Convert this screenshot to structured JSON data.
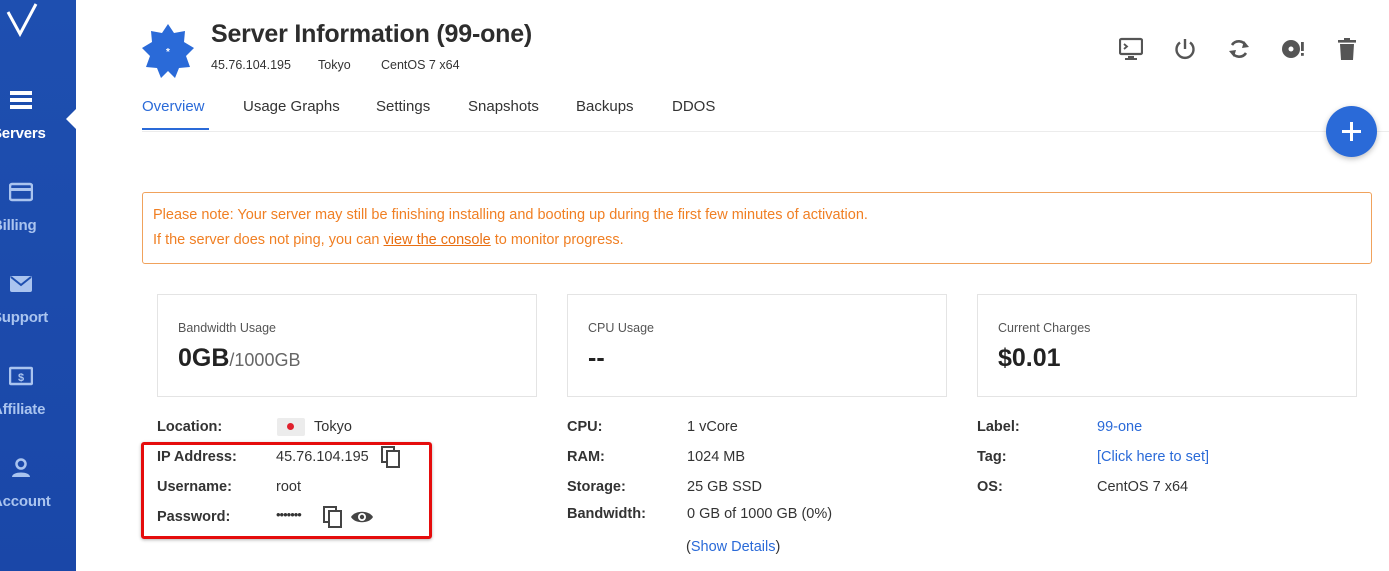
{
  "sidebar": {
    "items": [
      {
        "label": "Servers",
        "icon": "servers-icon",
        "active": true
      },
      {
        "label": "Billing",
        "icon": "billing-icon"
      },
      {
        "label": "Support",
        "icon": "support-icon"
      },
      {
        "label": "Affiliate",
        "icon": "affiliate-icon"
      },
      {
        "label": "Account",
        "icon": "account-icon"
      }
    ]
  },
  "header": {
    "title": "Server Information (99-one)",
    "ip": "45.76.104.195",
    "location": "Tokyo",
    "os": "CentOS 7 x64"
  },
  "toolbar": {
    "icons": [
      "console-icon",
      "power-icon",
      "restart-icon",
      "reinstall-icon",
      "delete-icon"
    ]
  },
  "tabs": [
    "Overview",
    "Usage Graphs",
    "Settings",
    "Snapshots",
    "Backups",
    "DDOS"
  ],
  "active_tab": "Overview",
  "notice": {
    "line1": "Please note: Your server may still be finishing installing and booting up during the first few minutes of activation.",
    "line2_prefix": "If the server does not ping, you can ",
    "line2_link": "view the console",
    "line2_suffix": " to monitor progress."
  },
  "cards": {
    "bandwidth": {
      "label": "Bandwidth Usage",
      "value": "0GB",
      "sub": "/1000GB"
    },
    "cpu": {
      "label": "CPU Usage",
      "value": "--"
    },
    "charges": {
      "label": "Current Charges",
      "value": "$0.01"
    }
  },
  "details": {
    "location": {
      "label": "Location:",
      "value": "Tokyo"
    },
    "ip": {
      "label": "IP Address:",
      "value": "45.76.104.195"
    },
    "username": {
      "label": "Username:",
      "value": "root"
    },
    "password": {
      "label": "Password:",
      "value": "•••••••"
    },
    "cpu": {
      "label": "CPU:",
      "value": "1 vCore"
    },
    "ram": {
      "label": "RAM:",
      "value": "1024 MB"
    },
    "storage": {
      "label": "Storage:",
      "value": "25 GB SSD"
    },
    "bandwidth": {
      "label": "Bandwidth:",
      "value": "0 GB of 1000 GB (0%)"
    },
    "show_details": {
      "open": "(",
      "link": "Show Details",
      "close": ")"
    },
    "label": {
      "label": "Label:",
      "value": "99-one"
    },
    "tag": {
      "label": "Tag:",
      "value": "[Click here to set]"
    },
    "os": {
      "label": "OS:",
      "value": "CentOS 7 x64"
    }
  },
  "colors": {
    "sidebar": "#1e4fb0",
    "accent": "#2a6ad8",
    "notice": "#f07f23",
    "highlight": "#e50c0c"
  }
}
